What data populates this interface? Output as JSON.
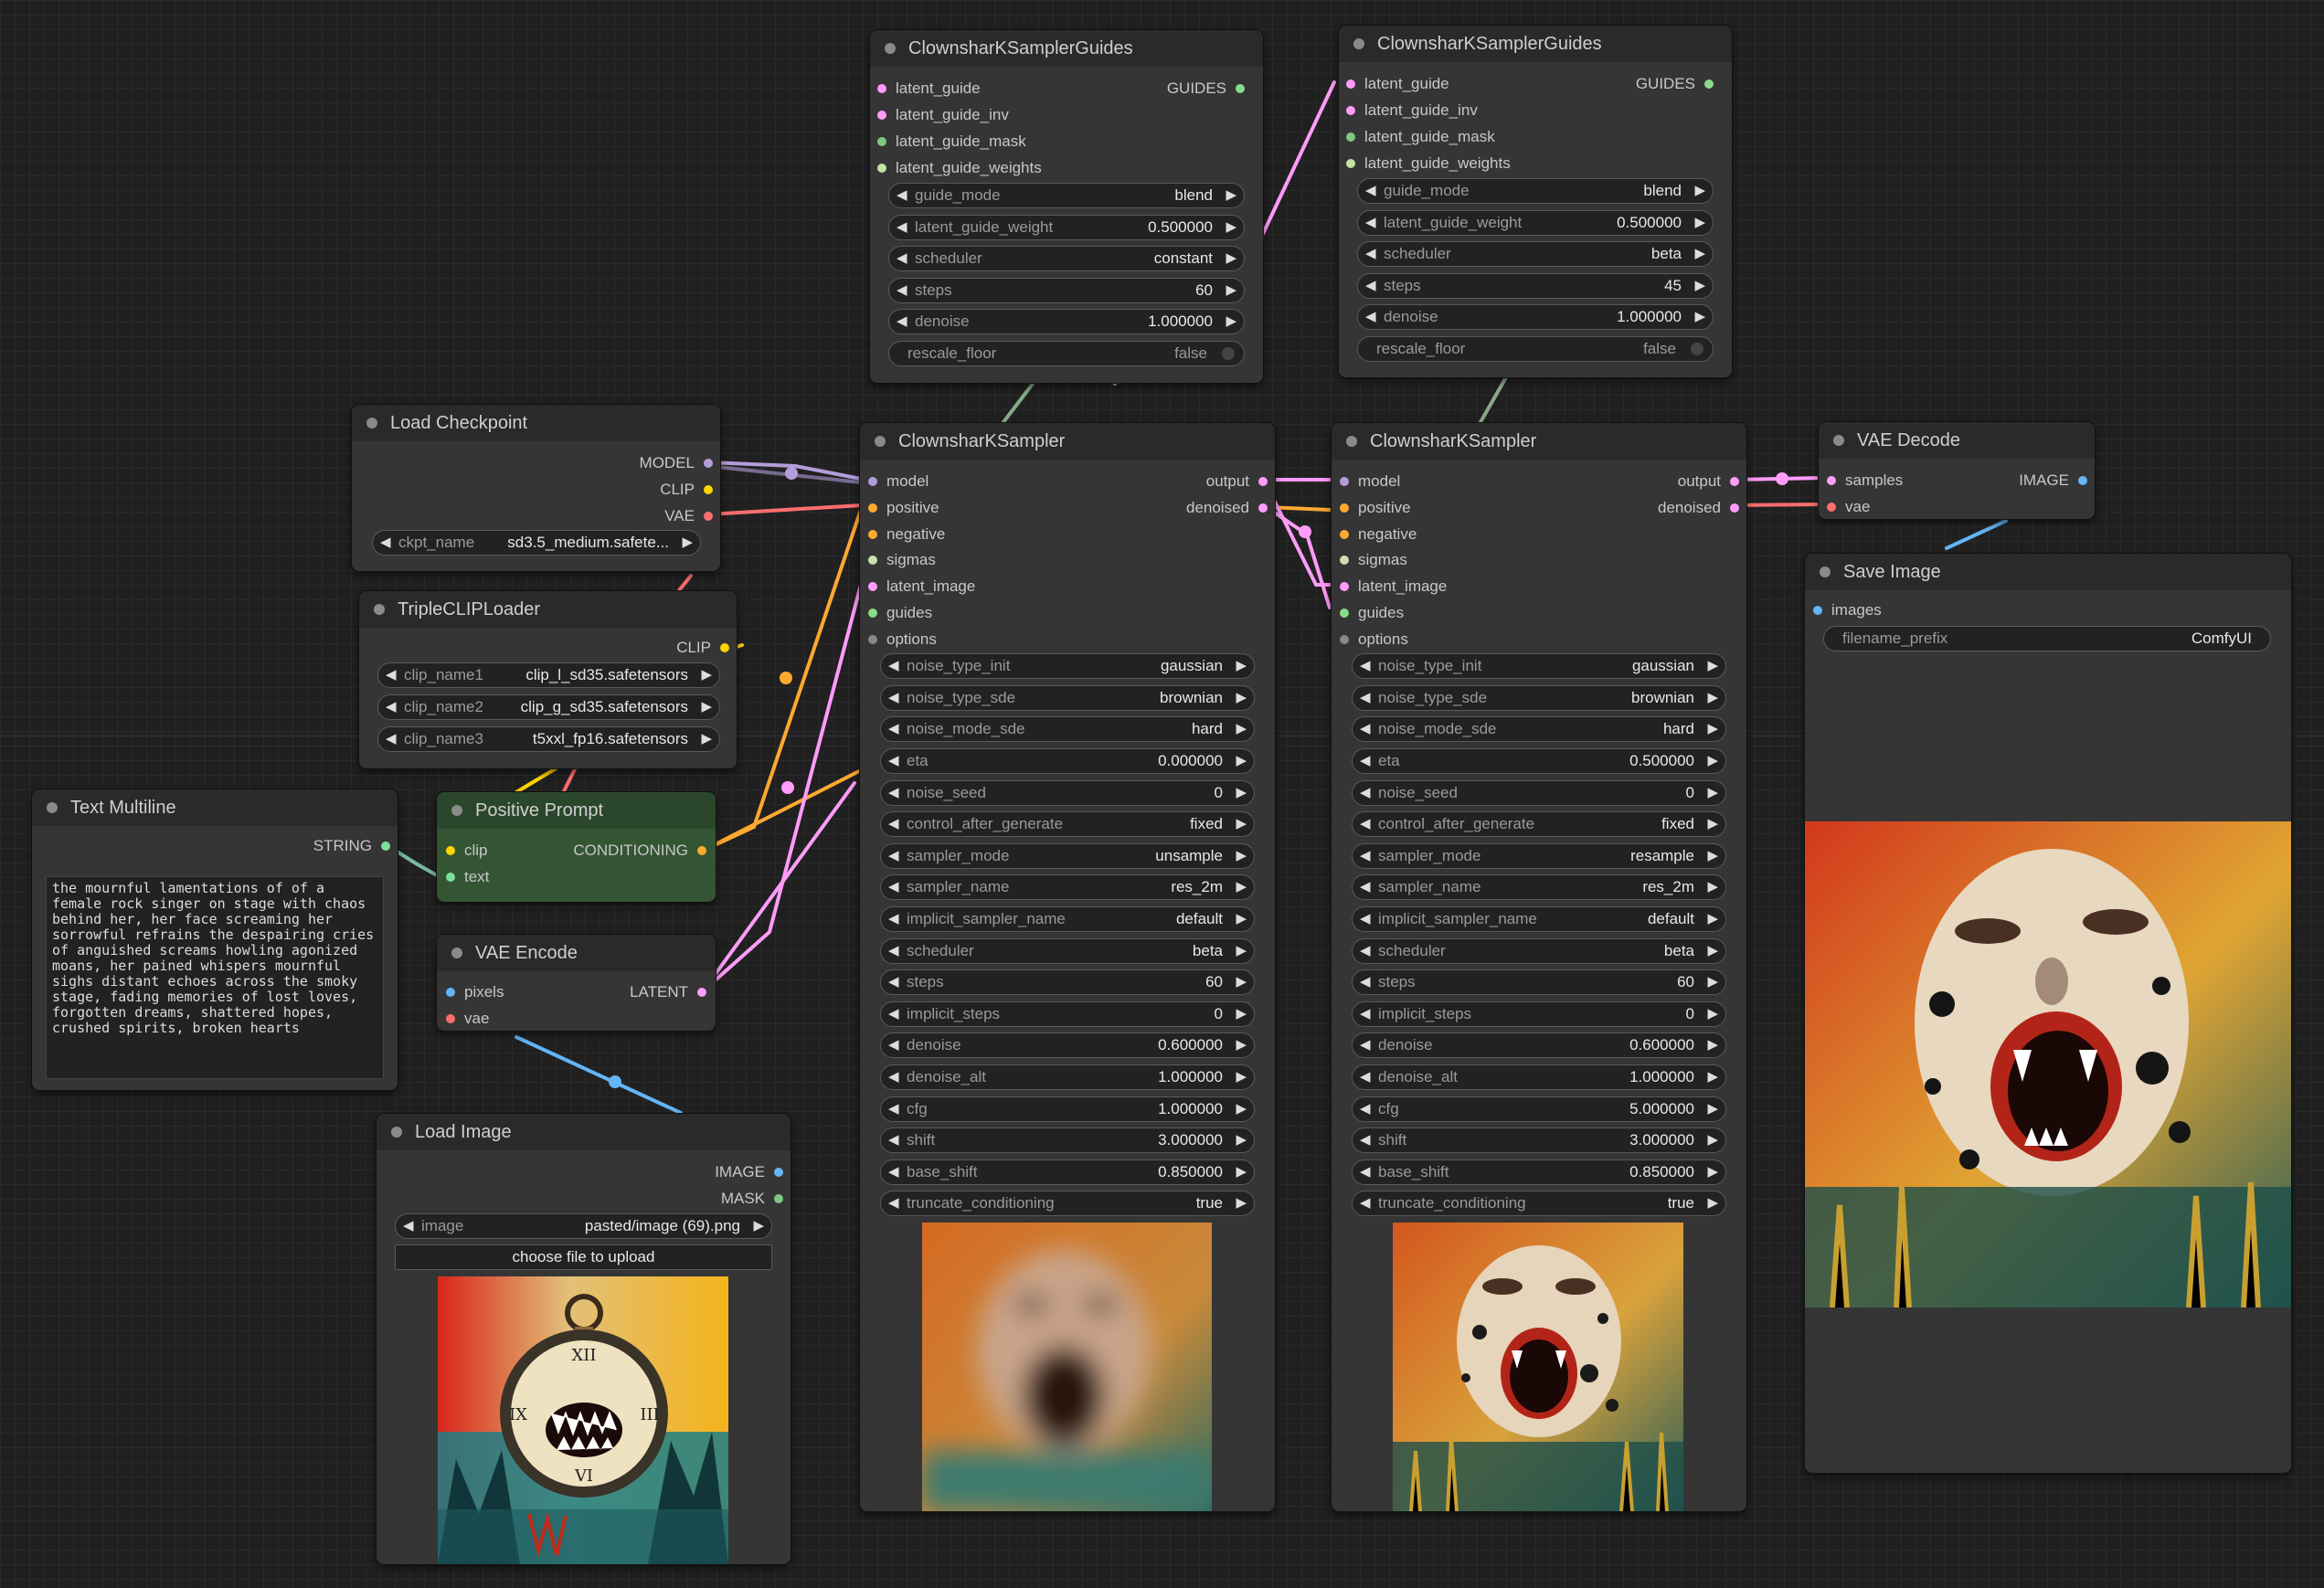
{
  "colors": {
    "background": "#202020",
    "node_body": "#353535",
    "node_title": "#2a2a2a",
    "green_node": "#335533",
    "model_wire": "#b39ddb",
    "clip_wire": "#ffd500",
    "vae_wire": "#ff6e6e",
    "conditioning_wire": "#ffa931",
    "latent_wire": "#ff9cf9",
    "image_wire": "#64b5f6",
    "string_wire": "#7ab8a0",
    "guides_wire": "#88aa88"
  },
  "nodes": {
    "guides1": {
      "title": "ClownsharKSamplerGuides",
      "inputs": [
        "latent_guide",
        "latent_guide_inv",
        "latent_guide_mask",
        "latent_guide_weights"
      ],
      "output": "GUIDES",
      "widgets": [
        {
          "label": "guide_mode",
          "value": "blend"
        },
        {
          "label": "latent_guide_weight",
          "value": "0.500000"
        },
        {
          "label": "scheduler",
          "value": "constant"
        },
        {
          "label": "steps",
          "value": "60"
        },
        {
          "label": "denoise",
          "value": "1.000000"
        }
      ],
      "toggle": {
        "label": "rescale_floor",
        "value": "false"
      }
    },
    "guides2": {
      "title": "ClownsharKSamplerGuides",
      "inputs": [
        "latent_guide",
        "latent_guide_inv",
        "latent_guide_mask",
        "latent_guide_weights"
      ],
      "output": "GUIDES",
      "widgets": [
        {
          "label": "guide_mode",
          "value": "blend"
        },
        {
          "label": "latent_guide_weight",
          "value": "0.500000"
        },
        {
          "label": "scheduler",
          "value": "beta"
        },
        {
          "label": "steps",
          "value": "45"
        },
        {
          "label": "denoise",
          "value": "1.000000"
        }
      ],
      "toggle": {
        "label": "rescale_floor",
        "value": "false"
      }
    },
    "checkpoint": {
      "title": "Load Checkpoint",
      "outputs": [
        "MODEL",
        "CLIP",
        "VAE"
      ],
      "widget": {
        "label": "ckpt_name",
        "value": "sd3.5_medium.safete..."
      }
    },
    "tripleclip": {
      "title": "TripleCLIPLoader",
      "output": "CLIP",
      "widgets": [
        {
          "label": "clip_name1",
          "value": "clip_l_sd35.safetensors"
        },
        {
          "label": "clip_name2",
          "value": "clip_g_sd35.safetensors"
        },
        {
          "label": "clip_name3",
          "value": "t5xxl_fp16.safetensors"
        }
      ]
    },
    "textmulti": {
      "title": "Text Multiline",
      "output": "STRING",
      "text": "the mournful lamentations of of a female rock singer on stage with chaos behind her, her face screaming her sorrowful refrains the despairing cries of anguished screams howling agonized moans, her pained whispers mournful sighs distant echoes across the smoky stage, fading memories of lost loves, forgotten dreams, shattered hopes, crushed spirits, broken hearts"
    },
    "posprompt": {
      "title": "Positive Prompt",
      "inputs": [
        "clip",
        "text"
      ],
      "output": "CONDITIONING"
    },
    "vaeencode": {
      "title": "VAE Encode",
      "inputs": [
        "pixels",
        "vae"
      ],
      "output": "LATENT"
    },
    "loadimage": {
      "title": "Load Image",
      "outputs": [
        "IMAGE",
        "MASK"
      ],
      "widget": {
        "label": "image",
        "value": "pasted/image (69).png"
      },
      "upload_label": "choose file to upload"
    },
    "sampler1": {
      "title": "ClownsharKSampler",
      "inputs": [
        "model",
        "positive",
        "negative",
        "sigmas",
        "latent_image",
        "guides",
        "options"
      ],
      "outputs": [
        "output",
        "denoised"
      ],
      "widgets": [
        {
          "label": "noise_type_init",
          "value": "gaussian"
        },
        {
          "label": "noise_type_sde",
          "value": "brownian"
        },
        {
          "label": "noise_mode_sde",
          "value": "hard"
        },
        {
          "label": "eta",
          "value": "0.000000"
        },
        {
          "label": "noise_seed",
          "value": "0"
        },
        {
          "label": "control_after_generate",
          "value": "fixed"
        },
        {
          "label": "sampler_mode",
          "value": "unsample"
        },
        {
          "label": "sampler_name",
          "value": "res_2m"
        },
        {
          "label": "implicit_sampler_name",
          "value": "default"
        },
        {
          "label": "scheduler",
          "value": "beta"
        },
        {
          "label": "steps",
          "value": "60"
        },
        {
          "label": "implicit_steps",
          "value": "0"
        },
        {
          "label": "denoise",
          "value": "0.600000"
        },
        {
          "label": "denoise_alt",
          "value": "1.000000"
        },
        {
          "label": "cfg",
          "value": "1.000000"
        },
        {
          "label": "shift",
          "value": "3.000000"
        },
        {
          "label": "base_shift",
          "value": "0.850000"
        },
        {
          "label": "truncate_conditioning",
          "value": "true"
        }
      ]
    },
    "sampler2": {
      "title": "ClownsharKSampler",
      "inputs": [
        "model",
        "positive",
        "negative",
        "sigmas",
        "latent_image",
        "guides",
        "options"
      ],
      "outputs": [
        "output",
        "denoised"
      ],
      "widgets": [
        {
          "label": "noise_type_init",
          "value": "gaussian"
        },
        {
          "label": "noise_type_sde",
          "value": "brownian"
        },
        {
          "label": "noise_mode_sde",
          "value": "hard"
        },
        {
          "label": "eta",
          "value": "0.500000"
        },
        {
          "label": "noise_seed",
          "value": "0"
        },
        {
          "label": "control_after_generate",
          "value": "fixed"
        },
        {
          "label": "sampler_mode",
          "value": "resample"
        },
        {
          "label": "sampler_name",
          "value": "res_2m"
        },
        {
          "label": "implicit_sampler_name",
          "value": "default"
        },
        {
          "label": "scheduler",
          "value": "beta"
        },
        {
          "label": "steps",
          "value": "60"
        },
        {
          "label": "implicit_steps",
          "value": "0"
        },
        {
          "label": "denoise",
          "value": "0.600000"
        },
        {
          "label": "denoise_alt",
          "value": "1.000000"
        },
        {
          "label": "cfg",
          "value": "5.000000"
        },
        {
          "label": "shift",
          "value": "3.000000"
        },
        {
          "label": "base_shift",
          "value": "0.850000"
        },
        {
          "label": "truncate_conditioning",
          "value": "true"
        }
      ]
    },
    "vaedecode": {
      "title": "VAE Decode",
      "inputs": [
        "samples",
        "vae"
      ],
      "output": "IMAGE"
    },
    "saveimage": {
      "title": "Save Image",
      "input": "images",
      "widget": {
        "label": "filename_prefix",
        "value": "ComfyUI"
      }
    }
  }
}
